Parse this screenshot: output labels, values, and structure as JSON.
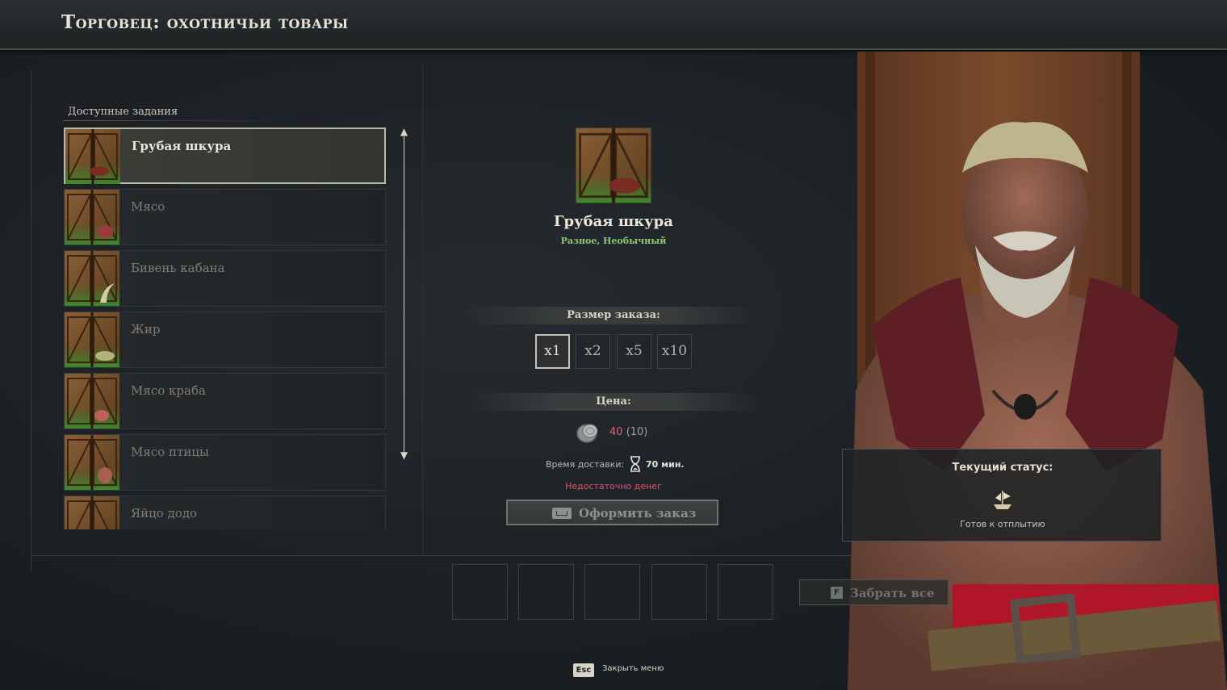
{
  "header": {
    "title": "Торговец: охотничьи товары"
  },
  "tasks": {
    "section_label": "Доступные задания",
    "items": [
      {
        "label": "Грубая шкура",
        "selected": true,
        "icon": "hide-icon"
      },
      {
        "label": "Мясо",
        "icon": "meat-icon"
      },
      {
        "label": "Бивень кабана",
        "icon": "tusk-icon"
      },
      {
        "label": "Жир",
        "icon": "fat-icon"
      },
      {
        "label": "Мясо краба",
        "icon": "crab-meat-icon"
      },
      {
        "label": "Мясо птицы",
        "icon": "poultry-icon"
      },
      {
        "label": "Яйцо додо",
        "icon": "egg-icon"
      }
    ]
  },
  "detail": {
    "name": "Грубая шкура",
    "tags": "Разное, Необычный",
    "order_size_label": "Размер заказа:",
    "quantities": [
      "x1",
      "x2",
      "x5",
      "x10"
    ],
    "selected_quantity": "x1",
    "price_label": "Цена:",
    "price_value": "40",
    "price_available": "(10)",
    "delivery_label": "Время доставки:",
    "delivery_value": "70 мин.",
    "warning": "Недостаточно денег",
    "order_button": "Оформить заказ"
  },
  "take_all": {
    "key": "F",
    "label": "Забрать все"
  },
  "status": {
    "title": "Текущий статус:",
    "value": "Готов к отплытию",
    "icon": "ship-icon"
  },
  "footer": {
    "key": "Esc",
    "label": "Закрыть меню"
  },
  "colors": {
    "accent_warning": "#d9566e",
    "rarity_uncommon": "#8fc67a",
    "price_current": "#e0607a"
  }
}
